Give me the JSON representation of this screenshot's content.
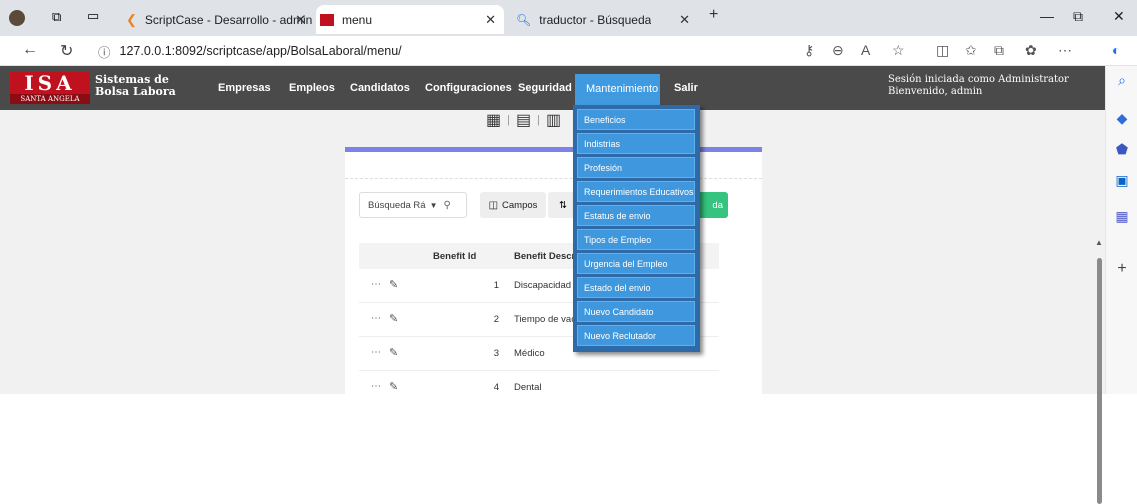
{
  "browser": {
    "tabs": [
      {
        "label": "ScriptCase - Desarrollo - admin"
      },
      {
        "label": "menu"
      },
      {
        "label": "traductor - Búsqueda"
      }
    ],
    "url": "127.0.0.1:8092/scriptcase/app/BolsaLaboral/menu/"
  },
  "app": {
    "logo_text": "ISA",
    "logo_subtext": "SANTA ANGELA",
    "title_line1": "Sistemas de",
    "title_line2": "Bolsa Labora",
    "menu": [
      "Empresas",
      "Empleos",
      "Candidatos",
      "Configuraciones",
      "Seguridad",
      "Mantenimiento",
      "Salir"
    ],
    "session_line1": "Sesión iniciada como Administrator",
    "session_line2": "Bienvenido, admin"
  },
  "dropdown": {
    "items": [
      "Beneficios",
      "Indistrias",
      "Profesión",
      "Requerimientos Educativos",
      "Estatus de envio",
      "Tipos de Empleo",
      "Urgencia del Empleo",
      "Estado del envio",
      "Nuevo Candidato",
      "Nuevo Reclutador"
    ]
  },
  "grid": {
    "search_placeholder": "Búsqueda Rá",
    "campos_label": "Campos",
    "green_button_label": "da",
    "columns": [
      "Benefit Id",
      "Benefit Descrip"
    ],
    "rows": [
      {
        "id": "1",
        "desc": "Discapacidad"
      },
      {
        "id": "2",
        "desc": "Tiempo de vaca"
      },
      {
        "id": "3",
        "desc": "Médico"
      },
      {
        "id": "4",
        "desc": "Dental"
      }
    ]
  },
  "colors": {
    "accent": "#3f9ae0",
    "navbar": "#4a4a4a",
    "success": "#35c37f",
    "logo_red": "#c0121e"
  }
}
